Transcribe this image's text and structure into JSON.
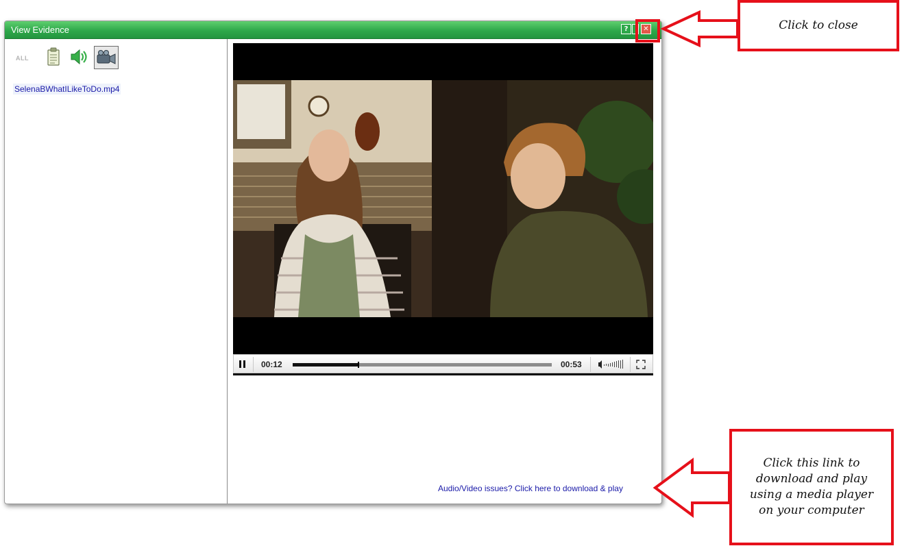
{
  "dialog": {
    "title": "View Evidence",
    "help_button": "?",
    "close_button": "✕"
  },
  "filters": {
    "all_label": "ALL",
    "icons": [
      "document-icon",
      "audio-icon",
      "video-icon"
    ],
    "selected": "video"
  },
  "files": [
    {
      "name": "SelenaBWhatILikeToDo.mp4"
    }
  ],
  "player": {
    "current_time": "00:12",
    "duration": "00:53",
    "progress": 0.25,
    "state": "playing"
  },
  "issue_link": "Audio/Video issues? Click here to download & play",
  "annotations": {
    "close_callout": "Click to close",
    "link_callout": "Click this link to download and play using a media player on your computer"
  },
  "colors": {
    "titlebar": "#2ea84a",
    "callout_border": "#e6101a",
    "link": "#1a1aa8"
  }
}
